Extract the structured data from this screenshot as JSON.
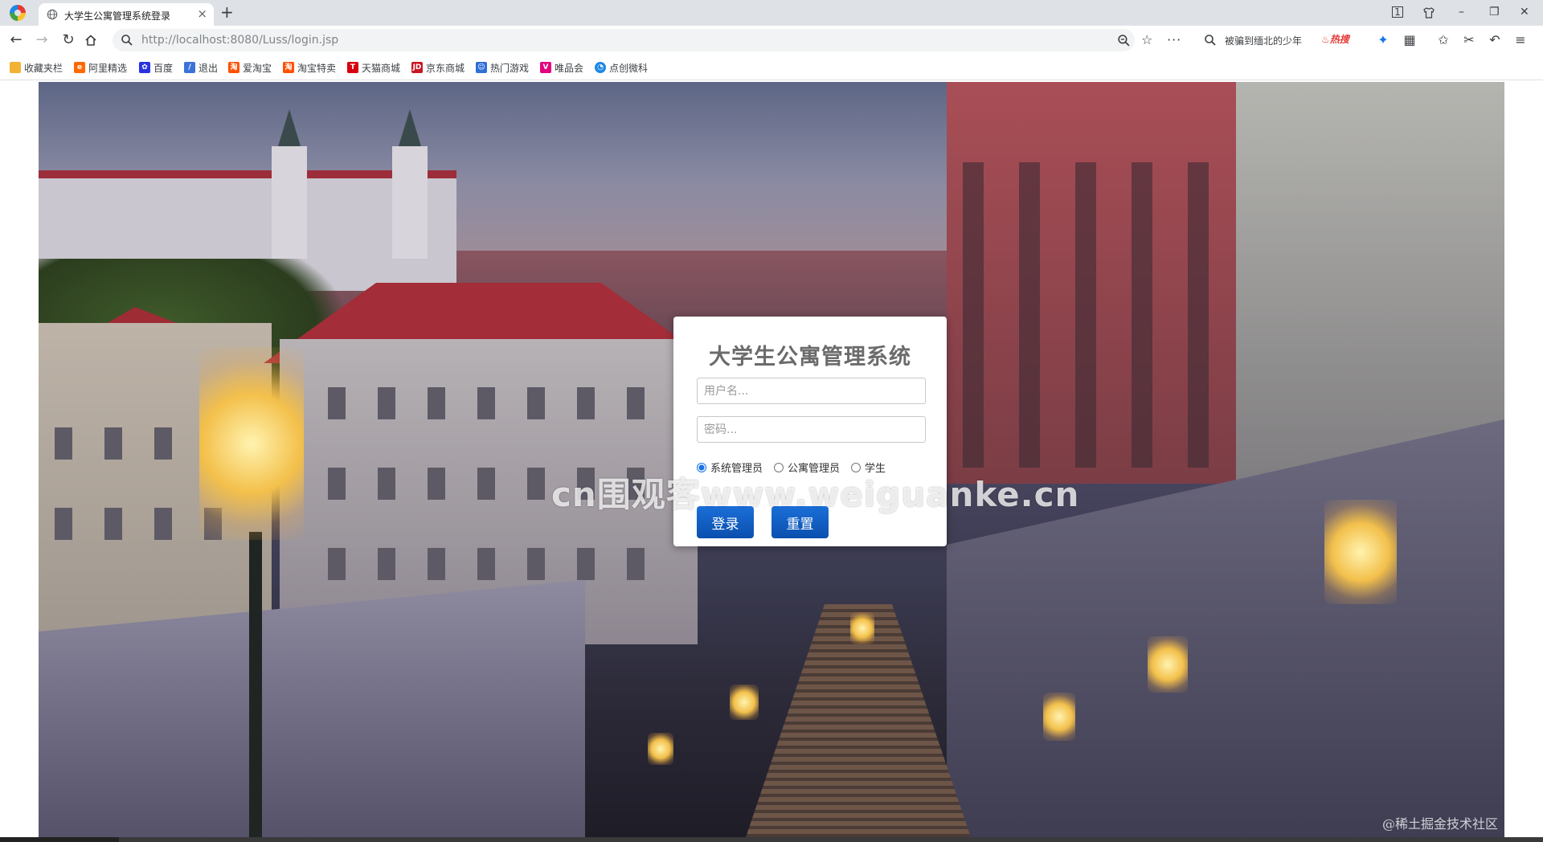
{
  "browser": {
    "tab_title": "大学生公寓管理系统登录",
    "tab_close": "×",
    "new_tab": "+",
    "url_host": "http://localhost",
    "url_rest": ":8080/Luss/login.jsp",
    "hot_search_text": "被骗到缅北的少年",
    "hot_badge": "热搜",
    "window_controls": {
      "minimize": "–",
      "maximize": "❐",
      "close": "✕"
    }
  },
  "bookmarks": [
    {
      "label": "收藏夹栏",
      "icon": "folder-icon",
      "color": "#f2b233"
    },
    {
      "label": "阿里精选",
      "icon": "ali-icon",
      "color": "#ff6a00"
    },
    {
      "label": "百度",
      "icon": "baidu-icon",
      "color": "#2932e1"
    },
    {
      "label": "退出",
      "icon": "feather-icon",
      "color": "#3b73d9"
    },
    {
      "label": "爱淘宝",
      "icon": "taobao-icon",
      "color": "#ff5000"
    },
    {
      "label": "淘宝特卖",
      "icon": "taobao-sale-icon",
      "color": "#ff5000"
    },
    {
      "label": "天猫商城",
      "icon": "tmall-icon",
      "color": "#d7000f"
    },
    {
      "label": "京东商城",
      "icon": "jd-icon",
      "color": "#c91623"
    },
    {
      "label": "热门游戏",
      "icon": "game-icon",
      "color": "#2f6fd6"
    },
    {
      "label": "唯品会",
      "icon": "vip-icon",
      "color": "#e4007f"
    },
    {
      "label": "点创微科",
      "icon": "weike-icon",
      "color": "#1e88e5"
    }
  ],
  "login": {
    "title": "大学生公寓管理系统",
    "username_placeholder": "用户名...",
    "password_placeholder": "密码...",
    "roles": [
      "系统管理员",
      "公寓管理员",
      "学生"
    ],
    "selected_role": "系统管理员",
    "login_button": "登录",
    "reset_button": "重置"
  },
  "overlay": {
    "watermark": "cn围观客www.weiguanke.cn",
    "corner_mark": "@稀土掘金技术社区"
  },
  "colors": {
    "accent": "#1a6fd8",
    "hot_badge": "#e53935",
    "tab_bar": "#dee1e6"
  }
}
